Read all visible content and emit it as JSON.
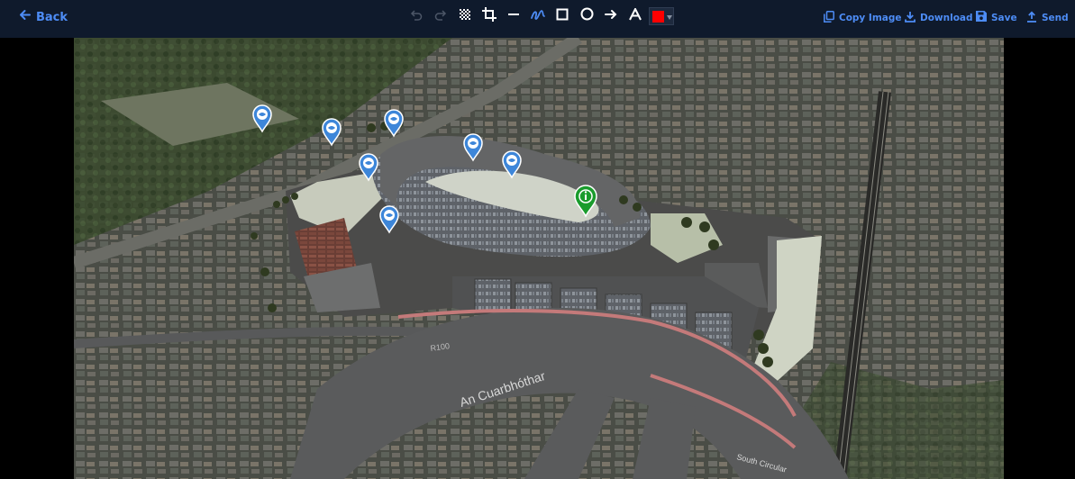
{
  "toolbar": {
    "back_label": "Back",
    "tools": [
      {
        "name": "undo",
        "icon": "undo-icon"
      },
      {
        "name": "redo",
        "icon": "redo-icon"
      },
      {
        "name": "blur",
        "icon": "blur-icon"
      },
      {
        "name": "crop",
        "icon": "crop-icon"
      },
      {
        "name": "line",
        "icon": "line-icon"
      },
      {
        "name": "freehand",
        "icon": "freehand-icon"
      },
      {
        "name": "rectangle",
        "icon": "rectangle-icon"
      },
      {
        "name": "circle",
        "icon": "circle-icon"
      },
      {
        "name": "arrow",
        "icon": "arrow-icon"
      },
      {
        "name": "text",
        "icon": "text-icon"
      }
    ],
    "selected_color": "#ff0000",
    "accent_color": "#4d8cf5",
    "actions": {
      "copy_image": "Copy Image",
      "download": "Download",
      "save": "Save",
      "send": "Send"
    }
  },
  "map": {
    "road_labels": {
      "an_cuarbhothar": "An Cuarbhóthar",
      "south_circular": "South Circular",
      "r100": "R100"
    },
    "markers": [
      {
        "type": "info",
        "color": "#1a9c2d",
        "icon": "info-marker-icon"
      },
      {
        "type": "view",
        "color": "#3d86d9",
        "icon": "eye-marker-icon",
        "count": 7
      }
    ]
  }
}
